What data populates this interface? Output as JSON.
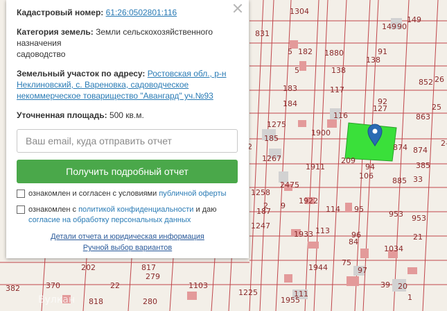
{
  "map": {
    "parcel_numbers": [
      "1304",
      "149",
      "90",
      "149",
      "5",
      "182",
      "5",
      "1880",
      "138",
      "91",
      "138",
      "26",
      "852",
      "1275",
      "1900",
      "116",
      "92",
      "127",
      "863",
      "25",
      "183",
      "184",
      "117",
      "185",
      "1267",
      "1911",
      "874",
      "94",
      "874",
      "1258",
      "2475",
      "1922",
      "106",
      "885",
      "33",
      "187",
      "114",
      "95",
      "1247",
      "1933",
      "113",
      "96",
      "84",
      "953",
      "1034",
      "953",
      "21",
      "1944",
      "97",
      "75",
      "1225",
      "1955",
      "111",
      "20",
      "39",
      "370",
      "382",
      "818",
      "22",
      "280",
      "1103",
      "202",
      "817",
      "279",
      "831",
      "2",
      "209",
      "2-9",
      "385",
      "1",
      "2",
      "9"
    ],
    "selected_parcel_color": "#3ae03a",
    "marker_color": "#2a6bb3"
  },
  "popup": {
    "cadastral_label": "Кадастровый номер:",
    "cadastral_value": "61:26:0502801:116",
    "category_label": "Категория земель:",
    "category_value": "Земли сельскохозяйственного назначения",
    "category_value2": "садоводство",
    "address_label": "Земельный участок по адресу:",
    "address_value": "Ростовская обл., р-н Неклиновский, с. Вареновка, садоводческое некоммерческое товарищество \"Авангард\" уч.№93",
    "area_label": "Уточненная площадь:",
    "area_value": "500 кв.м.",
    "email_placeholder": "Ваш email, куда отправить отчет",
    "submit_label": "Получить подробный отчет",
    "consent1_text": "ознакомлен и согласен с условиями",
    "consent1_link": "публичной оферты",
    "consent2_text": "ознакомлен с",
    "consent2_link1": "политикой конфиденциальности",
    "consent2_mid": "и даю",
    "consent2_link2": "согласие на обработку персональных данных",
    "details_link": "Детали отчета и юридическая информация",
    "manual_link": "Ручной выбор вариантов"
  },
  "watermark": "Вулкан"
}
